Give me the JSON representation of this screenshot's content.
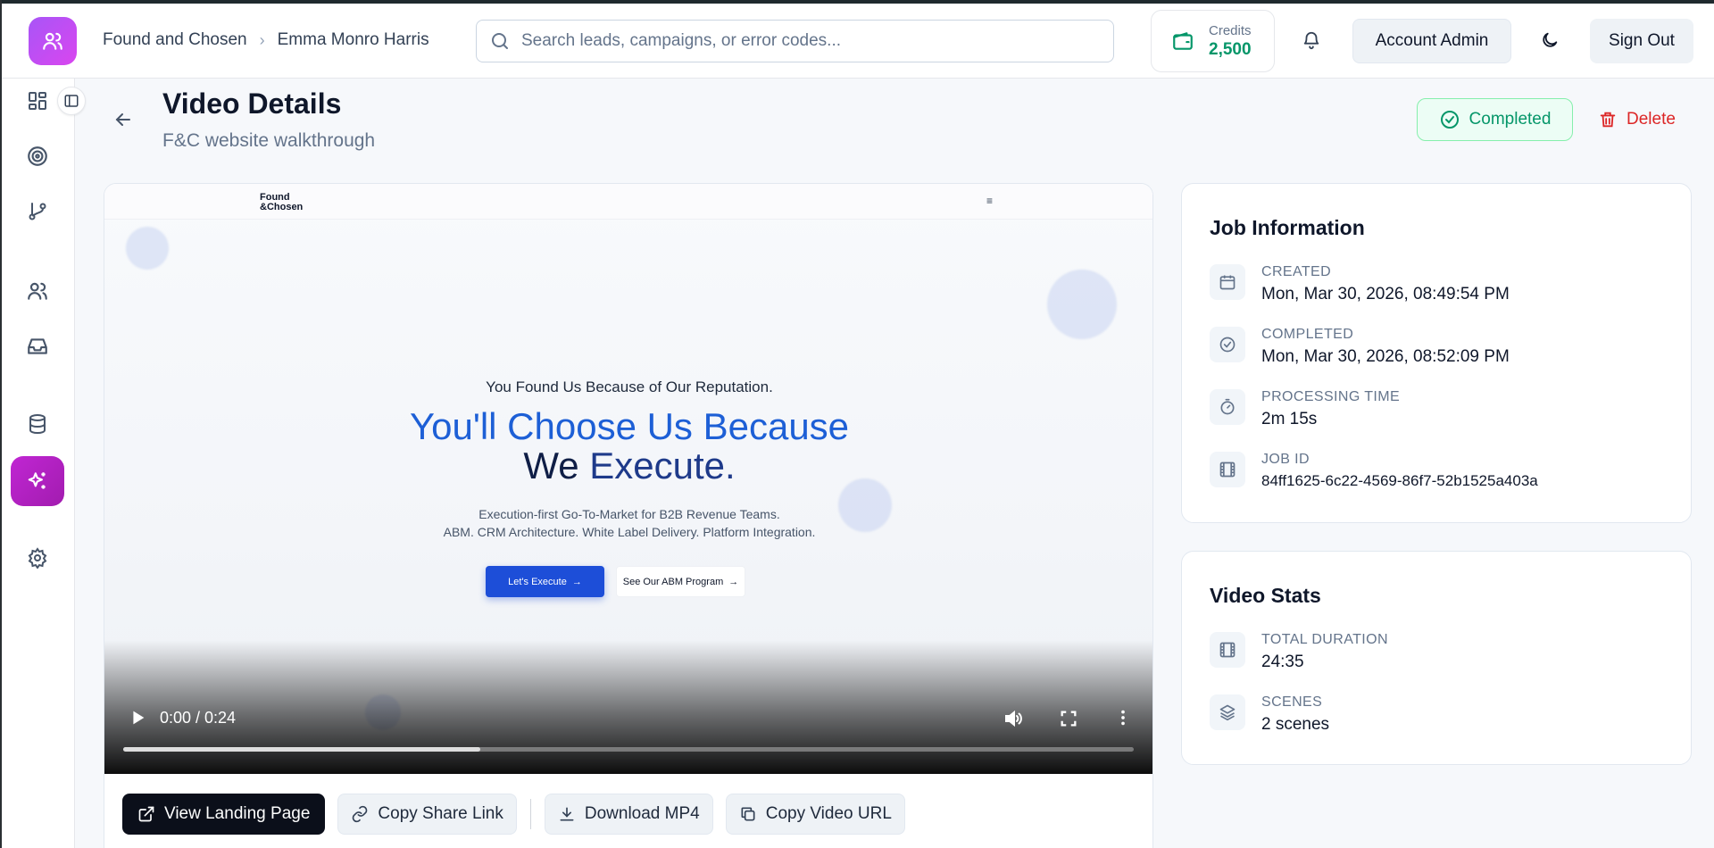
{
  "header": {
    "breadcrumb": [
      "Found and Chosen",
      "Emma Monro Harris"
    ],
    "search_placeholder": "Search leads, campaigns, or error codes...",
    "credits_label": "Credits",
    "credits_value": "2,500",
    "account_label": "Account Admin",
    "signout_label": "Sign Out"
  },
  "page": {
    "title": "Video Details",
    "subtitle": "F&C website walkthrough",
    "status": "Completed",
    "delete_label": "Delete"
  },
  "video": {
    "site_logo_line1": "Found",
    "site_logo_line2": "&Chosen",
    "site_menu": "≡",
    "hero_line1": "You Found Us Because of Our Reputation.",
    "hero_line2": "You'll Choose Us Because",
    "hero_line3a": "We ",
    "hero_line3b": "Execute.",
    "hero_desc1": "Execution-first Go-To-Market for B2B Revenue Teams.",
    "hero_desc2": "ABM. CRM Architecture. White Label Delivery. Platform Integration.",
    "cta_primary": "Let's Execute",
    "cta_secondary": "See Our ABM Program",
    "time_display": "0:00 / 0:24",
    "progress_fraction": 0.353
  },
  "actions": {
    "view_landing": "View Landing Page",
    "copy_share": "Copy Share Link",
    "download": "Download MP4",
    "copy_url": "Copy Video URL"
  },
  "job_info": {
    "title": "Job Information",
    "created_label": "CREATED",
    "created_value": "Mon, Mar 30, 2026, 08:49:54 PM",
    "completed_label": "COMPLETED",
    "completed_value": "Mon, Mar 30, 2026, 08:52:09 PM",
    "processing_label": "PROCESSING TIME",
    "processing_value": "2m 15s",
    "jobid_label": "JOB ID",
    "jobid_value": "84ff1625-6c22-4569-86f7-52b1525a403a"
  },
  "video_stats": {
    "title": "Video Stats",
    "duration_label": "TOTAL DURATION",
    "duration_value": "24:35",
    "scenes_label": "SCENES",
    "scenes_value": "2 scenes"
  },
  "colors": {
    "accent": "#c026d3",
    "success": "#059669",
    "danger": "#dc2626"
  }
}
